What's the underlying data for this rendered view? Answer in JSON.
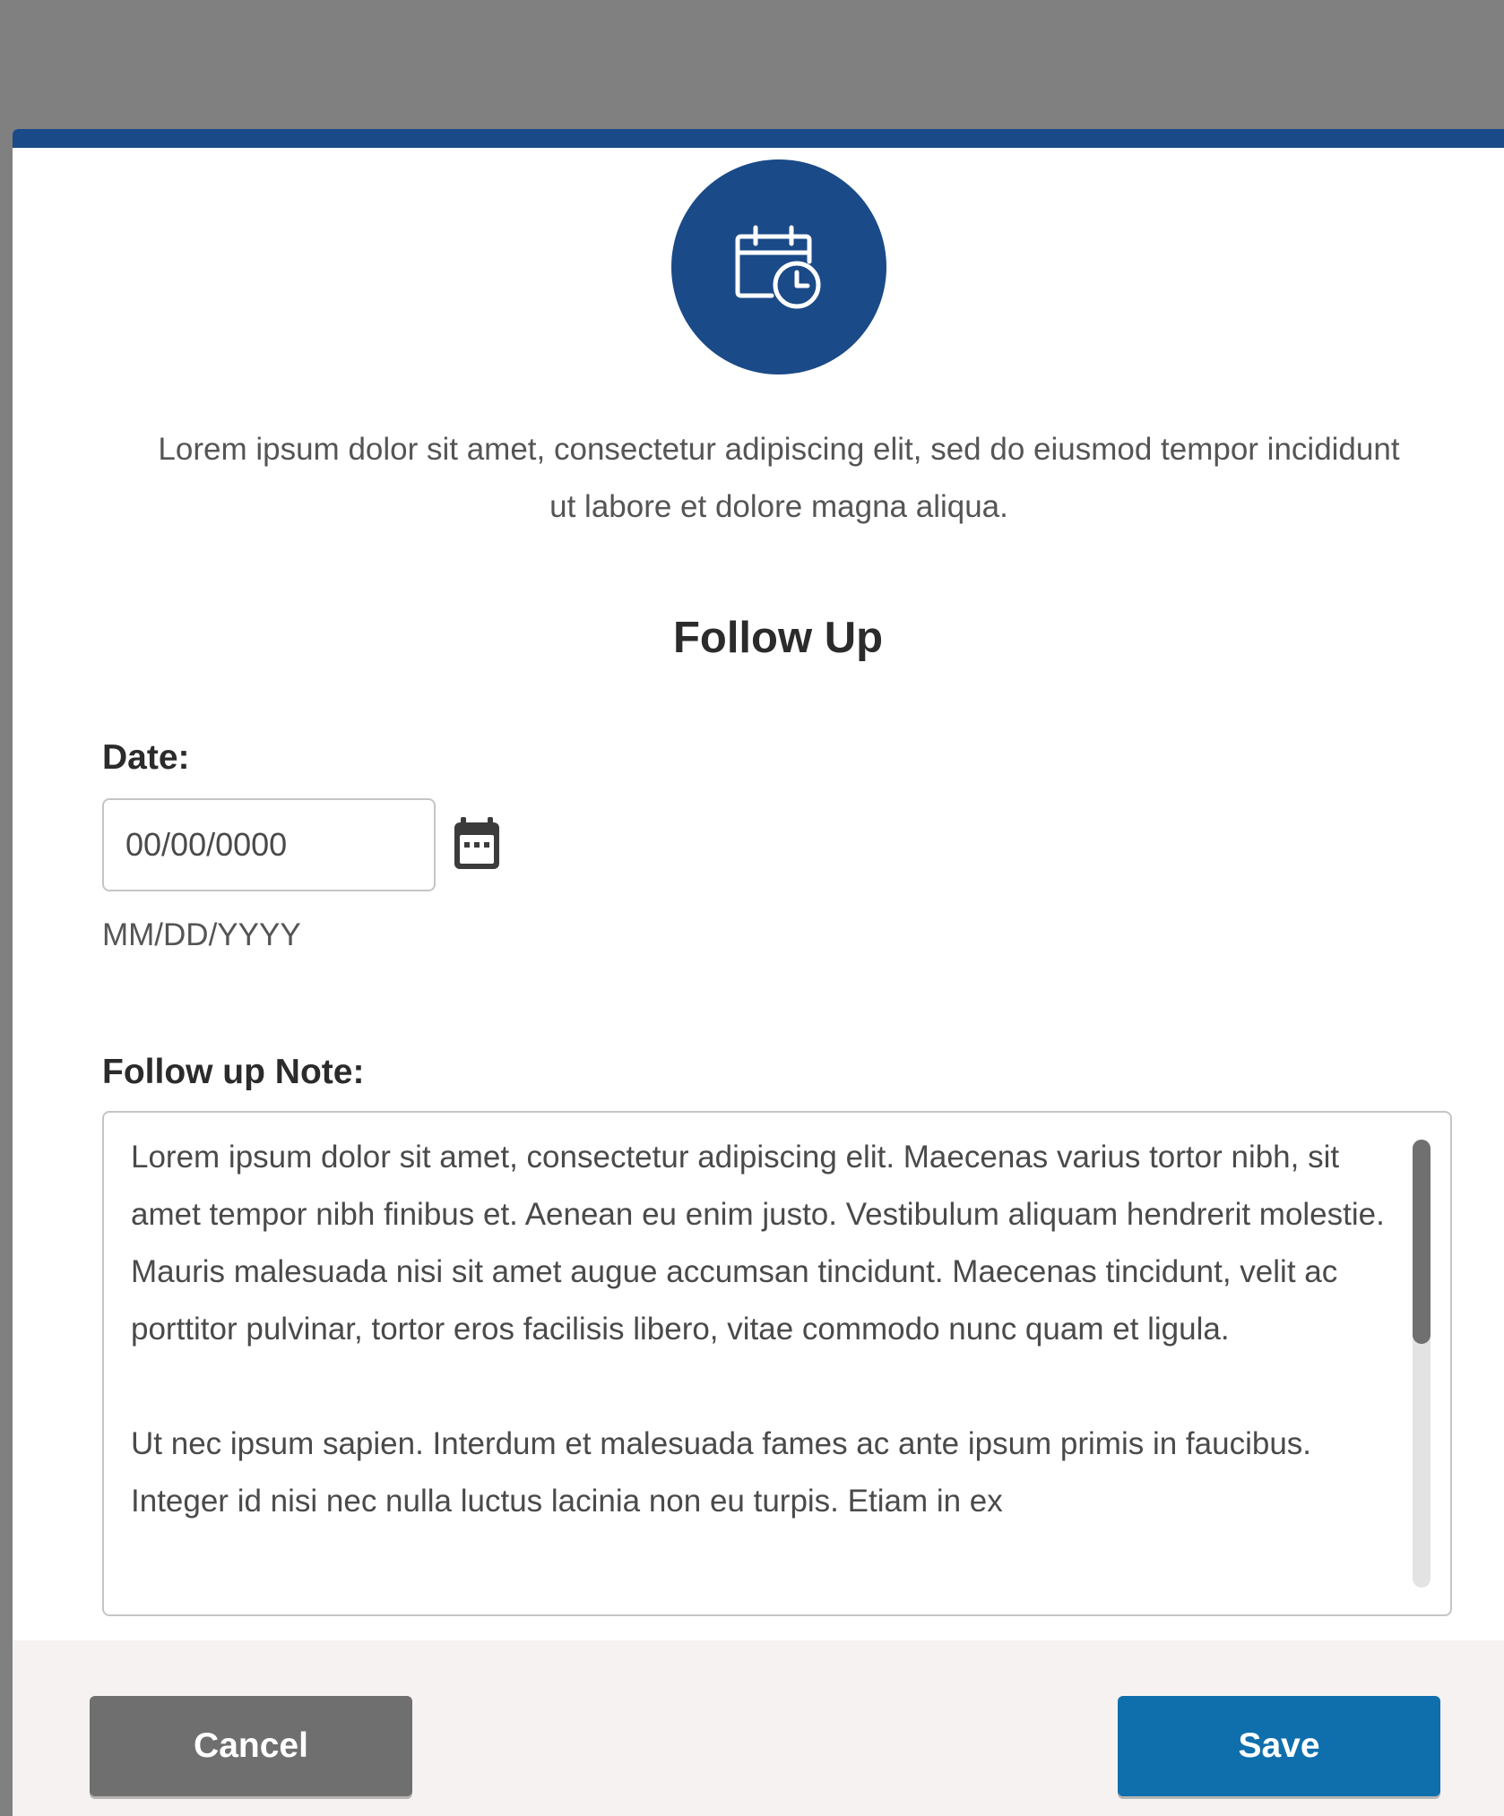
{
  "modal": {
    "header_icon": "calendar-clock-icon",
    "intro_text": "Lorem ipsum dolor sit amet, consectetur adipiscing elit, sed do eiusmod tempor incididunt ut labore et dolore magna aliqua.",
    "title": "Follow Up"
  },
  "date": {
    "label": "Date:",
    "value": "00/00/0000",
    "hint": "MM/DD/YYYY",
    "picker_icon": "calendar-icon"
  },
  "note": {
    "label": "Follow up Note:",
    "paragraphs": [
      "Lorem ipsum dolor sit amet, consectetur adipiscing elit. Maecenas varius tortor nibh, sit amet tempor nibh finibus et. Aenean eu enim justo. Vestibulum aliquam hendrerit molestie. Mauris malesuada nisi sit amet augue accumsan tincidunt. Maecenas tincidunt, velit ac porttitor pulvinar, tortor eros facilisis libero, vitae commodo nunc quam et ligula.",
      "Ut nec ipsum sapien. Interdum et malesuada fames ac ante ipsum primis in faucibus. Integer id nisi nec nulla luctus lacinia non eu turpis. Etiam in ex"
    ]
  },
  "footer": {
    "cancel_label": "Cancel",
    "save_label": "Save"
  },
  "colors": {
    "brand": "#1a4a87",
    "primary_button": "#0f6fad",
    "secondary_button": "#6f6f6f",
    "overlay": "#808080",
    "footer_bg": "#f5f2f1"
  }
}
